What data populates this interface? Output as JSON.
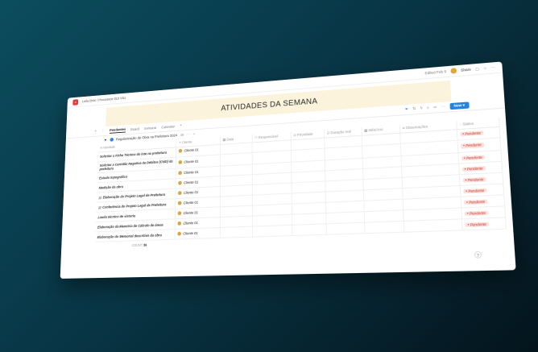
{
  "window": {
    "breadcrumb": "Leila Brito / Processos 010 V01",
    "edited": "Edited Feb 9",
    "share_label": "Share"
  },
  "banner": {
    "title": "ATIVIDADES DA SEMANA"
  },
  "views": [
    {
      "label": "Pendentes"
    },
    {
      "label": "Board"
    },
    {
      "label": "Semana"
    },
    {
      "label": "Calendar"
    }
  ],
  "toolbar": {
    "new_label": "New"
  },
  "group": {
    "title": "Regularização de Obra na Prefeitura 2024",
    "count": "36"
  },
  "table": {
    "columns": [
      "Atividade",
      "Cliente",
      "Data",
      "Responsável",
      "Prioridade",
      "Duração real",
      "Mês/Ano",
      "Observações",
      "Status"
    ],
    "rows": [
      {
        "activity": "Solicitar a Ficha Técnica do lote na prefeitura",
        "client": "Cliente 01",
        "status": "Pendente",
        "doc": false
      },
      {
        "activity": "Solicitar a Certidão Negativa de Débitos (CND) da prefeitura",
        "client": "Cliente 01",
        "status": "Pendente",
        "doc": false
      },
      {
        "activity": "Estudo topográfico",
        "client": "Cliente 01",
        "status": "Pendente",
        "doc": false
      },
      {
        "activity": "Medição da obra",
        "client": "Cliente 01",
        "status": "Pendente",
        "doc": false
      },
      {
        "activity": "Elaboração do Projeto Legal de Prefeitura",
        "client": "Cliente 01",
        "status": "Pendente",
        "doc": true
      },
      {
        "activity": "Conferência do Projeto Legal de Prefeitura",
        "client": "Cliente 01",
        "status": "Pendente",
        "doc": true
      },
      {
        "activity": "Laudo técnico de vistoria",
        "client": "Cliente 01",
        "status": "Pendente",
        "doc": false
      },
      {
        "activity": "Elaboração da Memória de Cálculo de áreas",
        "client": "Cliente 01",
        "status": "Pendente",
        "doc": false
      },
      {
        "activity": "Elaboração do Memorial descritivo da obra",
        "client": "Cliente 01",
        "status": "Pendente",
        "doc": false
      }
    ]
  },
  "footer": {
    "label": "COUNT",
    "value": "36"
  },
  "colors": {
    "accent": "#2383e2",
    "status_bg": "#fde0dc",
    "status_text": "#c4382c",
    "banner_bg": "#fbf3dc"
  }
}
